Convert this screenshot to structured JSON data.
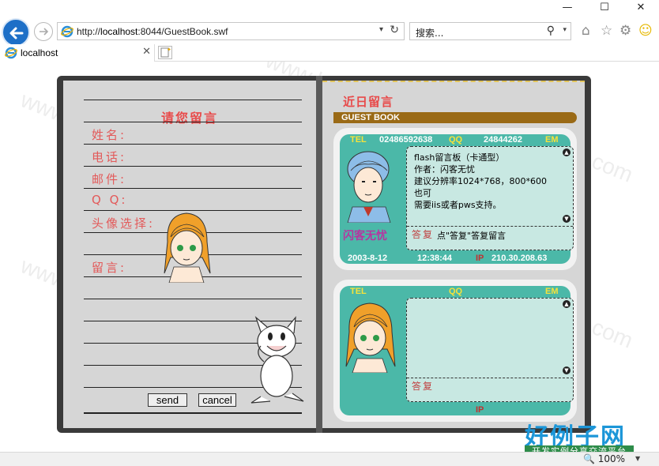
{
  "browser": {
    "address": "http://localhost:8044/GuestBook.swf",
    "address_prefix": "http://",
    "address_host": "localhost",
    "address_rest": ":8044/GuestBook.swf",
    "search_placeholder": "搜索...",
    "tab_title": "localhost",
    "zoom": "100%"
  },
  "form": {
    "title": "请您留言",
    "name_label": "姓名:",
    "phone_label": "电话:",
    "email_label": "邮件:",
    "qq_label": "Q Q:",
    "avatar_label": "头像选择:",
    "message_label": "留言:",
    "send_label": "send",
    "cancel_label": "cancel"
  },
  "guestbook": {
    "title": "近日留言",
    "banner": "GUEST BOOK",
    "tel_key": "TEL",
    "qq_key": "QQ",
    "em_key": "EM",
    "ip_key": "IP",
    "reply_key": "答复",
    "entries": [
      {
        "tel": "02486592638",
        "qq": "24844262",
        "em": "",
        "name": "闪客无忧",
        "message_lines": [
          "flash留言板（卡通型）",
          "作者：闪客无忧",
          "建议分辨率1024*768，800*600",
          "也可",
          "需要iis或者pws支持。"
        ],
        "reply": "点\"答复\"答复留言",
        "date": "2003-8-12",
        "time": "12:38:44",
        "ip": "210.30.208.63"
      },
      {
        "tel": "",
        "qq": "",
        "em": "",
        "name": "",
        "message_lines": [],
        "reply": "",
        "date": "",
        "time": "",
        "ip": ""
      }
    ]
  },
  "watermark": {
    "text": "www.haolizi.com",
    "logo_big": "好例子网",
    "logo_small": "开发实例分享交流平台"
  },
  "colors": {
    "accent_red": "#e84a4a",
    "card_teal": "#4bb8a8",
    "key_yellow": "#f6e23a",
    "banner_brown": "#9a6a16"
  }
}
